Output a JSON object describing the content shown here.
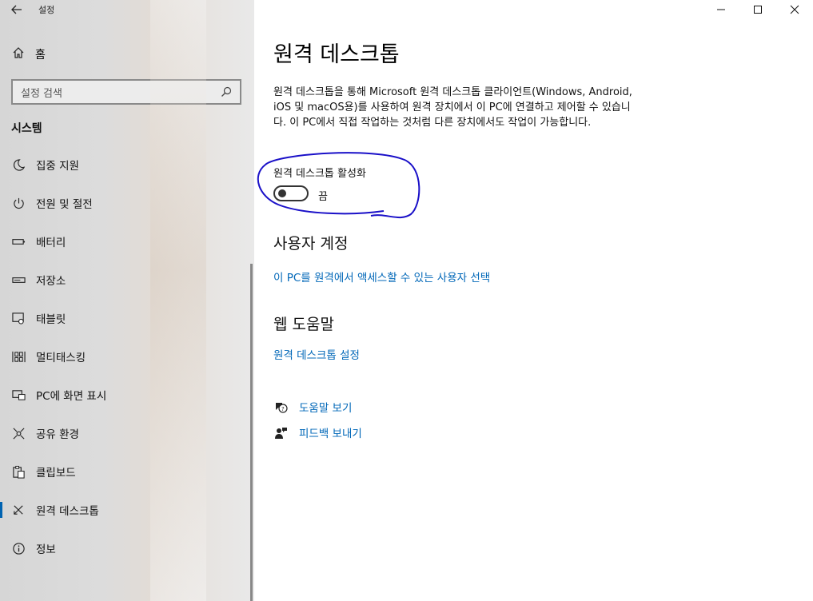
{
  "window": {
    "title": "설정",
    "minimize": "—",
    "maximize": "☐",
    "close": "✕"
  },
  "sidebar": {
    "home_label": "홈",
    "search_placeholder": "설정 검색",
    "section": "시스템",
    "items": [
      {
        "label": "집중 지원",
        "icon": "moon-icon"
      },
      {
        "label": "전원 및 절전",
        "icon": "power-icon"
      },
      {
        "label": "배터리",
        "icon": "battery-icon"
      },
      {
        "label": "저장소",
        "icon": "storage-icon"
      },
      {
        "label": "태블릿",
        "icon": "tablet-icon"
      },
      {
        "label": "멀티태스킹",
        "icon": "multitasking-icon"
      },
      {
        "label": "PC에 화면 표시",
        "icon": "project-icon"
      },
      {
        "label": "공유 환경",
        "icon": "share-icon"
      },
      {
        "label": "클립보드",
        "icon": "clipboard-icon"
      },
      {
        "label": "원격 데스크톱",
        "icon": "remote-icon",
        "active": true
      },
      {
        "label": "정보",
        "icon": "info-icon"
      }
    ]
  },
  "main": {
    "title": "원격 데스크톱",
    "description": "원격 데스크톱을 통해 Microsoft 원격 데스크톱 클라이언트(Windows, Android, iOS 및 macOS용)를 사용하여 원격 장치에서 이 PC에 연결하고 제어할 수 있습니다. 이 PC에서 직접 작업하는 것처럼 다른 장치에서도 작업이 가능합니다.",
    "toggle_label": "원격 데스크톱 활성화",
    "toggle_state": "끔",
    "toggle_on": false,
    "user_accounts_heading": "사용자 계정",
    "user_accounts_link": "이 PC를 원격에서 액세스할 수 있는 사용자 선택",
    "web_help_heading": "웹 도움말",
    "web_help_link": "원격 데스크톱 설정",
    "get_help": "도움말 보기",
    "give_feedback": "피드백 보내기"
  },
  "colors": {
    "accent": "#0067b8",
    "annotation": "#1a10c8"
  }
}
